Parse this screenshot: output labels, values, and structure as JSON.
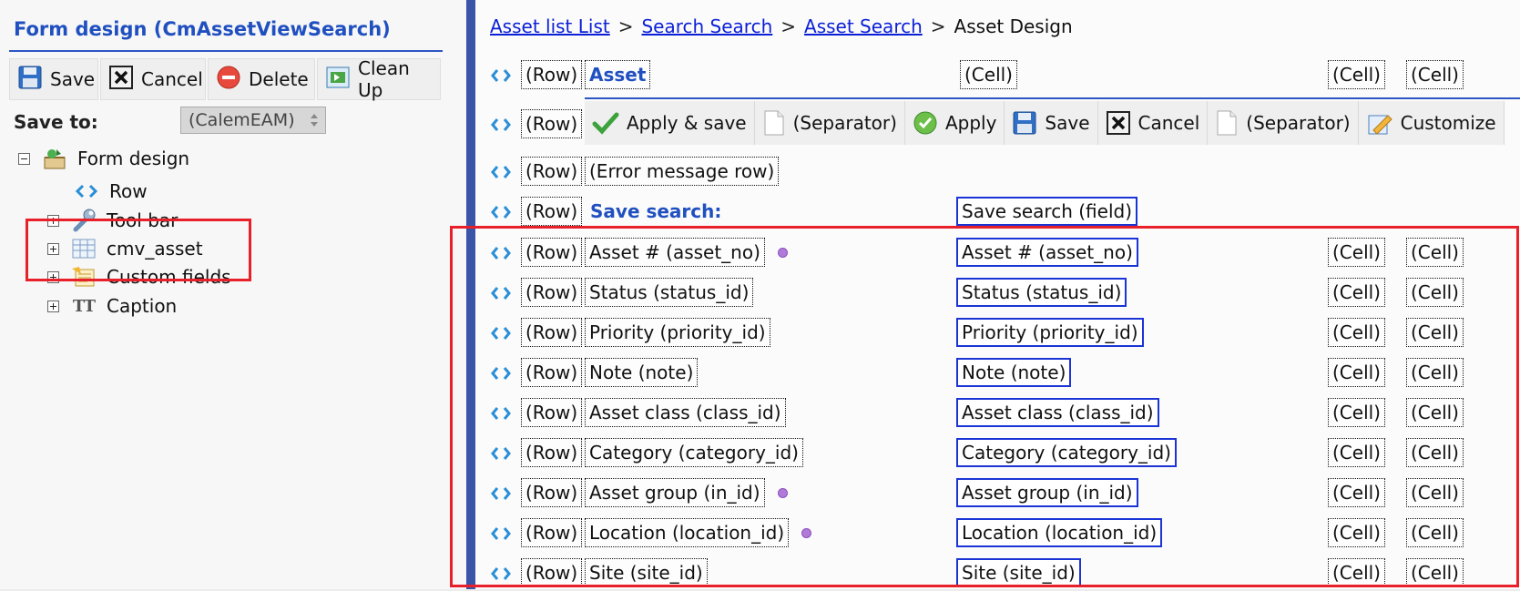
{
  "panel": {
    "title": "Form design (CmAssetViewSearch)",
    "toolbar": [
      {
        "label": "Save",
        "icon": "floppy-disk-icon"
      },
      {
        "label": "Cancel",
        "icon": "x-box-icon"
      },
      {
        "label": "Delete",
        "icon": "delete-icon"
      },
      {
        "label": "Clean Up",
        "icon": "clean-up-icon"
      }
    ],
    "save_to_label": "Save to:",
    "save_to_value": "(CalemEAM)",
    "tree": {
      "root": "Form design",
      "items": [
        {
          "label": "Row",
          "icon": "row-arrows-icon",
          "expandable": false
        },
        {
          "label": "Tool bar",
          "icon": "wrench-icon",
          "expandable": true
        },
        {
          "label": "cmv_asset",
          "icon": "table-icon",
          "expandable": true
        },
        {
          "label": "Custom fields",
          "icon": "custom-fields-icon",
          "expandable": true
        },
        {
          "label": "Caption",
          "icon": "caption-icon",
          "expandable": true
        }
      ]
    }
  },
  "breadcrumb": {
    "links": [
      "Asset list List",
      "Search Search",
      "Asset Search"
    ],
    "separator": ">",
    "current": "Asset Design"
  },
  "design": {
    "row_label": "(Row)",
    "cell_label": "(Cell)",
    "asset_title": "Asset",
    "toolbar": [
      {
        "label": "Apply & save",
        "icon": "checkmark-icon"
      },
      {
        "label": "(Separator)",
        "icon": "page-icon"
      },
      {
        "label": "Apply",
        "icon": "apply-circle-icon"
      },
      {
        "label": "Save",
        "icon": "floppy-disk-icon"
      },
      {
        "label": "Cancel",
        "icon": "x-box-icon"
      },
      {
        "label": "(Separator)",
        "icon": "page-icon"
      },
      {
        "label": "Customize",
        "icon": "customize-icon"
      }
    ],
    "error_row": "(Error message row)",
    "save_search_label": "Save search:",
    "save_search_field": "Save search (field)",
    "field_rows": [
      {
        "label": "Asset # (asset_no)",
        "field": "Asset # (asset_no)",
        "custom": true
      },
      {
        "label": "Status (status_id)",
        "field": "Status (status_id)",
        "custom": false
      },
      {
        "label": "Priority (priority_id)",
        "field": "Priority (priority_id)",
        "custom": false
      },
      {
        "label": "Note (note)",
        "field": "Note (note)",
        "custom": false
      },
      {
        "label": "Asset class (class_id)",
        "field": "Asset class (class_id)",
        "custom": false
      },
      {
        "label": "Category (category_id)",
        "field": "Category (category_id)",
        "custom": false
      },
      {
        "label": "Asset group (in_id)",
        "field": "Asset group (in_id)",
        "custom": true
      },
      {
        "label": "Location (location_id)",
        "field": "Location (location_id)",
        "custom": true
      },
      {
        "label": "Site (site_id)",
        "field": "Site (site_id)",
        "custom": false
      }
    ]
  },
  "colors": {
    "accent": "#2050c0",
    "link": "#0b1fd6",
    "highlight": "#e8202a",
    "field_border": "#1b34d6",
    "divider": "#3a55a8"
  }
}
